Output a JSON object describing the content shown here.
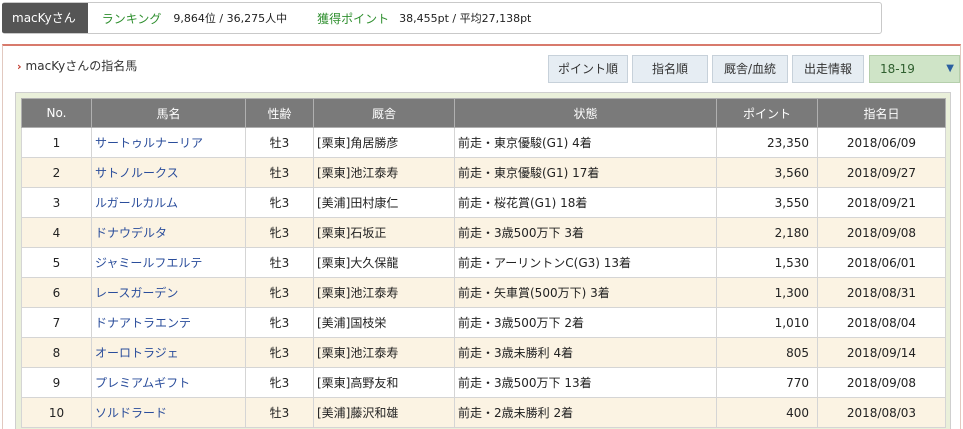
{
  "user": {
    "name": "macKyさん",
    "ranking_label": "ランキング",
    "ranking_value": "9,864位 / 36,275人中",
    "points_label": "獲得ポイント",
    "points_value": "38,455pt / 平均27,138pt"
  },
  "panel": {
    "title": "macKyさんの指名馬",
    "buttons": [
      "ポイント順",
      "指名順",
      "厩舎/血統",
      "出走情報"
    ],
    "year_selected": "18-19"
  },
  "table": {
    "headers": [
      "No.",
      "馬名",
      "性齢",
      "厩舎",
      "状態",
      "ポイント",
      "指名日"
    ],
    "rows": [
      {
        "no": "1",
        "name": "サートゥルナーリア",
        "sexage": "牡3",
        "stable": "[栗東]角居勝彦",
        "status": "前走・東京優駿(G1) 4着",
        "points": "23,350",
        "date": "2018/06/09"
      },
      {
        "no": "2",
        "name": "サトノルークス",
        "sexage": "牡3",
        "stable": "[栗東]池江泰寿",
        "status": "前走・東京優駿(G1) 17着",
        "points": "3,560",
        "date": "2018/09/27"
      },
      {
        "no": "3",
        "name": "ルガールカルム",
        "sexage": "牝3",
        "stable": "[美浦]田村康仁",
        "status": "前走・桜花賞(G1) 18着",
        "points": "3,550",
        "date": "2018/09/21"
      },
      {
        "no": "4",
        "name": "ドナウデルタ",
        "sexage": "牝3",
        "stable": "[栗東]石坂正",
        "status": "前走・3歳500万下 3着",
        "points": "2,180",
        "date": "2018/09/08"
      },
      {
        "no": "5",
        "name": "ジャミールフエルテ",
        "sexage": "牡3",
        "stable": "[栗東]大久保龍",
        "status": "前走・アーリントンC(G3) 13着",
        "points": "1,530",
        "date": "2018/06/01"
      },
      {
        "no": "6",
        "name": "レースガーデン",
        "sexage": "牝3",
        "stable": "[栗東]池江泰寿",
        "status": "前走・矢車賞(500万下) 3着",
        "points": "1,300",
        "date": "2018/08/31"
      },
      {
        "no": "7",
        "name": "ドナアトラエンテ",
        "sexage": "牝3",
        "stable": "[美浦]国枝栄",
        "status": "前走・3歳500万下 2着",
        "points": "1,010",
        "date": "2018/08/04"
      },
      {
        "no": "8",
        "name": "オーロトラジェ",
        "sexage": "牝3",
        "stable": "[栗東]池江泰寿",
        "status": "前走・3歳未勝利 4着",
        "points": "805",
        "date": "2018/09/14"
      },
      {
        "no": "9",
        "name": "プレミアムギフト",
        "sexage": "牝3",
        "stable": "[栗東]高野友和",
        "status": "前走・3歳500万下 13着",
        "points": "770",
        "date": "2018/09/08"
      },
      {
        "no": "10",
        "name": "ソルドラード",
        "sexage": "牡3",
        "stable": "[美浦]藤沢和雄",
        "status": "前走・2歳未勝利 2着",
        "points": "400",
        "date": "2018/08/03"
      }
    ]
  },
  "colors": {
    "header_gray": "#7a7a7a",
    "row_alt": "#fbf3e3",
    "link_blue": "#2a4d9b",
    "label_green": "#2f8f2f",
    "panel_border": "#d87a6c"
  }
}
